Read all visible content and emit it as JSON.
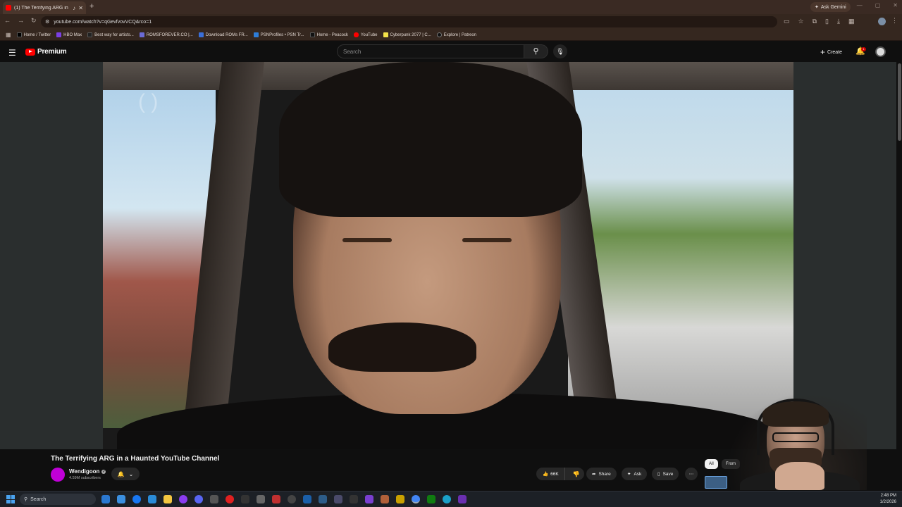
{
  "browser": {
    "tab_title": "(1) The Terrifying ARG in a H...",
    "gemini_label": "Ask Gemini",
    "url": "youtube.com/watch?v=qGevfvovVCQ&rco=1"
  },
  "bookmarks": [
    {
      "label": "Home / Twitter",
      "color": "#000000"
    },
    {
      "label": "HBO Max",
      "color": "#7b3fe4"
    },
    {
      "label": "Best way for artists...",
      "color": "#222222"
    },
    {
      "label": "ROMSFOREVER.CO |...",
      "color": "#6b6bd6"
    },
    {
      "label": "Download ROMs FR...",
      "color": "#3a6fd8"
    },
    {
      "label": "PSNProfiles • PSN Tr...",
      "color": "#2e7dd8"
    },
    {
      "label": "Home - Peacock",
      "color": "#111111"
    },
    {
      "label": "YouTube",
      "color": "#ff0000"
    },
    {
      "label": "Cyberpunk 2077 | C...",
      "color": "#f2e24a"
    },
    {
      "label": "Explore | Patreon",
      "color": "#111111"
    }
  ],
  "youtube": {
    "logo_text": "Premium",
    "search_placeholder": "Search",
    "create_label": "Create",
    "notification_count": "1"
  },
  "video": {
    "title": "The Terrifying ARG in a Haunted YouTube Channel",
    "channel": "Wendigoon",
    "subscribers": "4.59M subscribers",
    "likes": "66K",
    "share_label": "Share",
    "ask_label": "Ask",
    "save_label": "Save"
  },
  "chips": [
    "All",
    "From"
  ],
  "taskbar": {
    "search_label": "Search",
    "time": "2:48 PM",
    "date": "1/2/2026"
  },
  "colors": {
    "yt_red": "#ff0000",
    "browser_frame": "#3a2a23",
    "page_bg": "#0f0f0f"
  }
}
